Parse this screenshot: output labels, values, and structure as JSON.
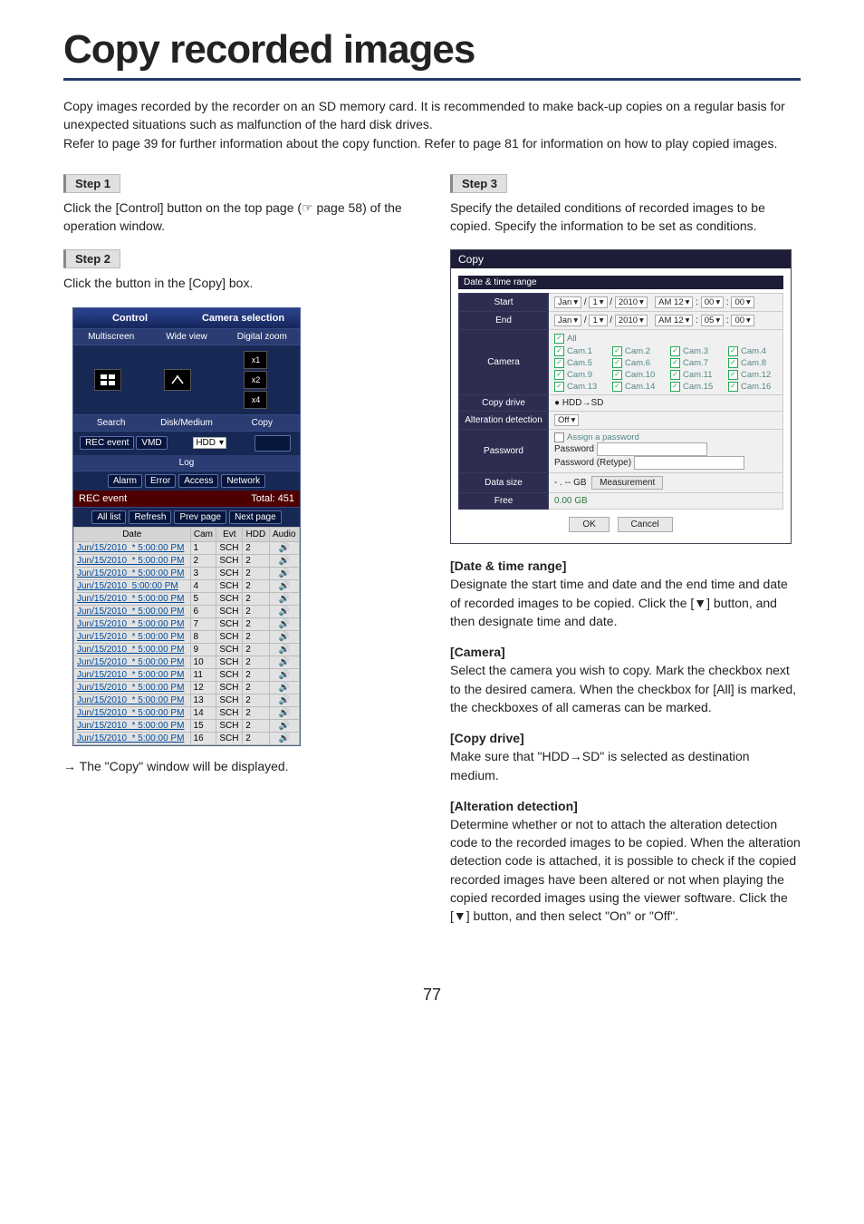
{
  "title": "Copy recorded images",
  "intro": "Copy images recorded by the recorder on an SD memory card. It is recommended to make back-up copies on a regular basis for unexpected situations such as malfunction of the hard disk drives.\nRefer to page 39 for further information about the copy function. Refer to page 81 for information on how to play copied images.",
  "page_number": "77",
  "left": {
    "step1_label": "Step 1",
    "step1_text": "Click the [Control] button on the top page (☞ page 58) of the operation window.",
    "step2_label": "Step 2",
    "step2_text": "Click the button in the [Copy] box.",
    "after_panel": "→ The \"Copy\" window will be displayed."
  },
  "control_panel": {
    "hdr_control": "Control",
    "hdr_camsel": "Camera selection",
    "lbl_multiscreen": "Multiscreen",
    "lbl_wideview": "Wide view",
    "lbl_digitalzoom": "Digital zoom",
    "zoom_x1": "x1",
    "zoom_x2": "x2",
    "zoom_x4": "x4",
    "lbl_search": "Search",
    "lbl_diskmedium": "Disk/Medium",
    "lbl_copy": "Copy",
    "btn_recevent": "REC event",
    "btn_vmd": "VMD",
    "sel_hdd": "HDD",
    "lbl_log": "Log",
    "btn_alarm": "Alarm",
    "btn_error": "Error",
    "btn_access": "Access",
    "btn_network": "Network",
    "lbl_recevent": "REC event",
    "lbl_total": "Total: 451",
    "btn_alllist": "All list",
    "btn_refresh": "Refresh",
    "btn_prev": "Prev page",
    "btn_next": "Next page",
    "cols": {
      "date": "Date",
      "cam": "Cam",
      "evt": "Evt",
      "hdd": "HDD",
      "audio": "Audio"
    },
    "rows": [
      {
        "date": "Jun/15/2010",
        "time": "* 5:00:00 PM",
        "cam": "1",
        "evt": "SCH",
        "hdd": "2"
      },
      {
        "date": "Jun/15/2010",
        "time": "* 5:00:00 PM",
        "cam": "2",
        "evt": "SCH",
        "hdd": "2"
      },
      {
        "date": "Jun/15/2010",
        "time": "* 5:00:00 PM",
        "cam": "3",
        "evt": "SCH",
        "hdd": "2"
      },
      {
        "date": "Jun/15/2010",
        "time": "5:00:00 PM",
        "cam": "4",
        "evt": "SCH",
        "hdd": "2"
      },
      {
        "date": "Jun/15/2010",
        "time": "* 5:00:00 PM",
        "cam": "5",
        "evt": "SCH",
        "hdd": "2"
      },
      {
        "date": "Jun/15/2010",
        "time": "* 5:00:00 PM",
        "cam": "6",
        "evt": "SCH",
        "hdd": "2"
      },
      {
        "date": "Jun/15/2010",
        "time": "* 5:00:00 PM",
        "cam": "7",
        "evt": "SCH",
        "hdd": "2"
      },
      {
        "date": "Jun/15/2010",
        "time": "* 5:00:00 PM",
        "cam": "8",
        "evt": "SCH",
        "hdd": "2"
      },
      {
        "date": "Jun/15/2010",
        "time": "* 5:00:00 PM",
        "cam": "9",
        "evt": "SCH",
        "hdd": "2"
      },
      {
        "date": "Jun/15/2010",
        "time": "* 5:00:00 PM",
        "cam": "10",
        "evt": "SCH",
        "hdd": "2"
      },
      {
        "date": "Jun/15/2010",
        "time": "* 5:00:00 PM",
        "cam": "11",
        "evt": "SCH",
        "hdd": "2"
      },
      {
        "date": "Jun/15/2010",
        "time": "* 5:00:00 PM",
        "cam": "12",
        "evt": "SCH",
        "hdd": "2"
      },
      {
        "date": "Jun/15/2010",
        "time": "* 5:00:00 PM",
        "cam": "13",
        "evt": "SCH",
        "hdd": "2"
      },
      {
        "date": "Jun/15/2010",
        "time": "* 5:00:00 PM",
        "cam": "14",
        "evt": "SCH",
        "hdd": "2"
      },
      {
        "date": "Jun/15/2010",
        "time": "* 5:00:00 PM",
        "cam": "15",
        "evt": "SCH",
        "hdd": "2"
      },
      {
        "date": "Jun/15/2010",
        "time": "* 5:00:00 PM",
        "cam": "16",
        "evt": "SCH",
        "hdd": "2"
      }
    ]
  },
  "right": {
    "step3_label": "Step 3",
    "step3_text": "Specify the detailed conditions of recorded images to be copied. Specify the information to be set as conditions.",
    "dt_heading": "[Date & time range]",
    "dt_text": "Designate the start time and date and the end time and date of recorded images to be copied. Click the [▼] button, and then designate time and date.",
    "cam_heading": "[Camera]",
    "cam_text": "Select the camera you wish to copy. Mark the checkbox next to the desired camera. When the checkbox for [All] is marked, the checkboxes of all cameras can be marked.",
    "cd_heading": "[Copy drive]",
    "cd_text": "Make sure that \"HDD→SD\" is selected as destination medium.",
    "ad_heading": "[Alteration detection]",
    "ad_text": "Determine whether or not to attach the alteration detection code to the recorded images to be copied. When the alteration detection code is attached, it is possible to check if the copied recorded images have been altered or not when playing the copied recorded images using the viewer software. Click the [▼] button, and then select \"On\" or \"Off\"."
  },
  "copy_dialog": {
    "title": "Copy",
    "section_range": "Date & time range",
    "lbl_start": "Start",
    "lbl_end": "End",
    "start": {
      "mon": "Jan",
      "day": "1",
      "year": "2010",
      "ampm": "AM 12",
      "min": "00",
      "sec": "00"
    },
    "end": {
      "mon": "Jan",
      "day": "1",
      "year": "2010",
      "ampm": "AM 12",
      "min": "05",
      "sec": "00"
    },
    "lbl_camera": "Camera",
    "all": "All",
    "cams": [
      "Cam.1",
      "Cam.2",
      "Cam.3",
      "Cam.4",
      "Cam.5",
      "Cam.6",
      "Cam.7",
      "Cam.8",
      "Cam.9",
      "Cam.10",
      "Cam.11",
      "Cam.12",
      "Cam.13",
      "Cam.14",
      "Cam.15",
      "Cam.16"
    ],
    "lbl_copydrive": "Copy drive",
    "copydrive_val": "● HDD→SD",
    "lbl_alteration": "Alteration detection",
    "alteration_val": "Off",
    "lbl_password": "Password",
    "assign_pw": "Assign a password",
    "pw_label": "Password",
    "pw_retype": "Password (Retype)",
    "lbl_datasize": "Data size",
    "datasize_val": "- . -- GB",
    "measurement_btn": "Measurement",
    "lbl_free": "Free",
    "free_val": "0.00 GB",
    "btn_ok": "OK",
    "btn_cancel": "Cancel"
  }
}
